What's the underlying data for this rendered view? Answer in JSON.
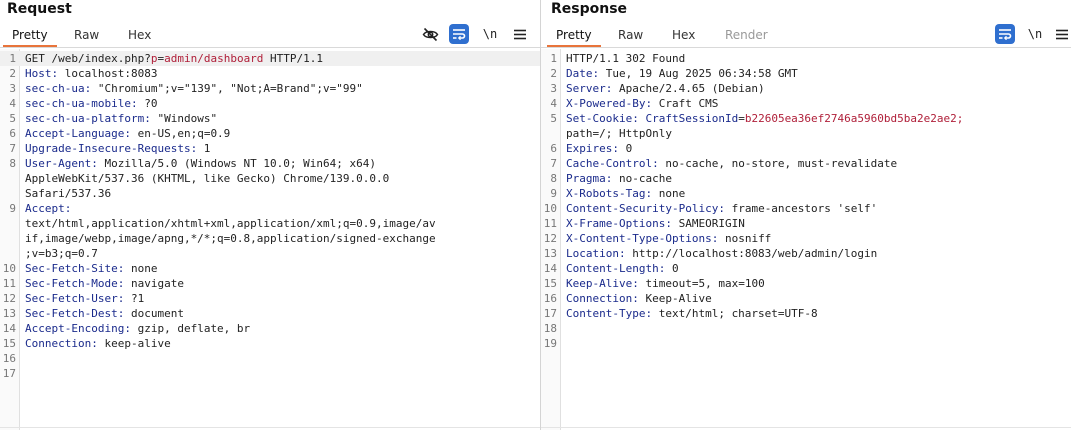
{
  "request": {
    "title": "Request",
    "tabs": [
      "Pretty",
      "Raw",
      "Hex"
    ],
    "active_tab": "Pretty",
    "newline_toggle": "\\n",
    "lines": [
      {
        "num": "1",
        "parts": [
          {
            "t": "GET /web/index.php?"
          },
          {
            "t": "p",
            "c": "red"
          },
          {
            "t": "="
          },
          {
            "t": "admin/dashboard",
            "c": "red"
          },
          {
            "t": " HTTP/1.1"
          }
        ],
        "hl": true
      },
      {
        "num": "2",
        "parts": [
          {
            "t": "Host:",
            "c": "hk"
          },
          {
            "t": " localhost:8083"
          }
        ]
      },
      {
        "num": "3",
        "parts": [
          {
            "t": "sec-ch-ua:",
            "c": "hk"
          },
          {
            "t": " \"Chromium\";v=\"139\", \"Not;A=Brand\";v=\"99\""
          }
        ]
      },
      {
        "num": "4",
        "parts": [
          {
            "t": "sec-ch-ua-mobile:",
            "c": "hk"
          },
          {
            "t": " ?0"
          }
        ]
      },
      {
        "num": "5",
        "parts": [
          {
            "t": "sec-ch-ua-platform:",
            "c": "hk"
          },
          {
            "t": " \"Windows\""
          }
        ]
      },
      {
        "num": "6",
        "parts": [
          {
            "t": "Accept-Language:",
            "c": "hk"
          },
          {
            "t": " en-US,en;q=0.9"
          }
        ]
      },
      {
        "num": "7",
        "parts": [
          {
            "t": "Upgrade-Insecure-Requests:",
            "c": "hk"
          },
          {
            "t": " 1"
          }
        ]
      },
      {
        "num": "8",
        "parts": [
          {
            "t": "User-Agent:",
            "c": "hk"
          },
          {
            "t": " Mozilla/5.0 (Windows NT 10.0; Win64; x64)"
          }
        ]
      },
      {
        "num": "",
        "parts": [
          {
            "t": "AppleWebKit/537.36 (KHTML, like Gecko) Chrome/139.0.0.0"
          }
        ]
      },
      {
        "num": "",
        "parts": [
          {
            "t": "Safari/537.36"
          }
        ]
      },
      {
        "num": "9",
        "parts": [
          {
            "t": "Accept:",
            "c": "hk"
          }
        ]
      },
      {
        "num": "",
        "parts": [
          {
            "t": "text/html,application/xhtml+xml,application/xml;q=0.9,image/av"
          }
        ]
      },
      {
        "num": "",
        "parts": [
          {
            "t": "if,image/webp,image/apng,*/*;q=0.8,application/signed-exchange"
          }
        ]
      },
      {
        "num": "",
        "parts": [
          {
            "t": ";v=b3;q=0.7"
          }
        ]
      },
      {
        "num": "10",
        "parts": [
          {
            "t": "Sec-Fetch-Site:",
            "c": "hk"
          },
          {
            "t": " none"
          }
        ]
      },
      {
        "num": "11",
        "parts": [
          {
            "t": "Sec-Fetch-Mode:",
            "c": "hk"
          },
          {
            "t": " navigate"
          }
        ]
      },
      {
        "num": "12",
        "parts": [
          {
            "t": "Sec-Fetch-User:",
            "c": "hk"
          },
          {
            "t": " ?1"
          }
        ]
      },
      {
        "num": "13",
        "parts": [
          {
            "t": "Sec-Fetch-Dest:",
            "c": "hk"
          },
          {
            "t": " document"
          }
        ]
      },
      {
        "num": "14",
        "parts": [
          {
            "t": "Accept-Encoding:",
            "c": "hk"
          },
          {
            "t": " gzip, deflate, br"
          }
        ]
      },
      {
        "num": "15",
        "parts": [
          {
            "t": "Connection:",
            "c": "hk"
          },
          {
            "t": " keep-alive"
          }
        ]
      },
      {
        "num": "16",
        "parts": []
      },
      {
        "num": "17",
        "parts": []
      }
    ]
  },
  "response": {
    "title": "Response",
    "tabs": [
      "Pretty",
      "Raw",
      "Hex",
      "Render"
    ],
    "active_tab": "Pretty",
    "disabled_tab": "Render",
    "newline_toggle": "\\n",
    "lines": [
      {
        "num": "1",
        "parts": [
          {
            "t": "HTTP/1.1 302 Found"
          }
        ]
      },
      {
        "num": "2",
        "parts": [
          {
            "t": "Date:",
            "c": "hk"
          },
          {
            "t": " Tue, 19 Aug 2025 06:34:58 GMT"
          }
        ]
      },
      {
        "num": "3",
        "parts": [
          {
            "t": "Server:",
            "c": "hk"
          },
          {
            "t": " Apache/2.4.65 (Debian)"
          }
        ]
      },
      {
        "num": "4",
        "parts": [
          {
            "t": "X-Powered-By:",
            "c": "hk"
          },
          {
            "t": " Craft CMS"
          }
        ]
      },
      {
        "num": "5",
        "parts": [
          {
            "t": "Set-Cookie:",
            "c": "hk"
          },
          {
            "t": " "
          },
          {
            "t": "CraftSessionId",
            "c": "hk"
          },
          {
            "t": "="
          },
          {
            "t": "b22605ea36ef2746a5960bd5ba2e2ae2;",
            "c": "red"
          }
        ]
      },
      {
        "num": "",
        "parts": [
          {
            "t": "path=/; HttpOnly"
          }
        ]
      },
      {
        "num": "6",
        "parts": [
          {
            "t": "Expires:",
            "c": "hk"
          },
          {
            "t": " 0"
          }
        ]
      },
      {
        "num": "7",
        "parts": [
          {
            "t": "Cache-Control:",
            "c": "hk"
          },
          {
            "t": " no-cache, no-store, must-revalidate"
          }
        ]
      },
      {
        "num": "8",
        "parts": [
          {
            "t": "Pragma:",
            "c": "hk"
          },
          {
            "t": " no-cache"
          }
        ]
      },
      {
        "num": "9",
        "parts": [
          {
            "t": "X-Robots-Tag:",
            "c": "hk"
          },
          {
            "t": " none"
          }
        ]
      },
      {
        "num": "10",
        "parts": [
          {
            "t": "Content-Security-Policy:",
            "c": "hk"
          },
          {
            "t": " frame-ancestors 'self'"
          }
        ]
      },
      {
        "num": "11",
        "parts": [
          {
            "t": "X-Frame-Options:",
            "c": "hk"
          },
          {
            "t": " SAMEORIGIN"
          }
        ]
      },
      {
        "num": "12",
        "parts": [
          {
            "t": "X-Content-Type-Options:",
            "c": "hk"
          },
          {
            "t": " nosniff"
          }
        ]
      },
      {
        "num": "13",
        "parts": [
          {
            "t": "Location:",
            "c": "hk"
          },
          {
            "t": " http://localhost:8083/web/admin/login"
          }
        ]
      },
      {
        "num": "14",
        "parts": [
          {
            "t": "Content-Length:",
            "c": "hk"
          },
          {
            "t": " 0"
          }
        ]
      },
      {
        "num": "15",
        "parts": [
          {
            "t": "Keep-Alive:",
            "c": "hk"
          },
          {
            "t": " timeout=5, max=100"
          }
        ]
      },
      {
        "num": "16",
        "parts": [
          {
            "t": "Connection:",
            "c": "hk"
          },
          {
            "t": " Keep-Alive"
          }
        ]
      },
      {
        "num": "17",
        "parts": [
          {
            "t": "Content-Type:",
            "c": "hk"
          },
          {
            "t": " text/html; charset=UTF-8"
          }
        ]
      },
      {
        "num": "18",
        "parts": []
      },
      {
        "num": "19",
        "parts": []
      }
    ]
  },
  "colors": {
    "accent_tab_underline": "#e8743b",
    "header_key": "#1b2b8c",
    "highlight_value": "#b0203a",
    "wrap_button_bg": "#2f6fcf"
  },
  "icons": {
    "hide_icon": "eye-off-icon",
    "wrap_icon": "word-wrap-icon",
    "menu_icon": "hamburger-menu-icon"
  }
}
